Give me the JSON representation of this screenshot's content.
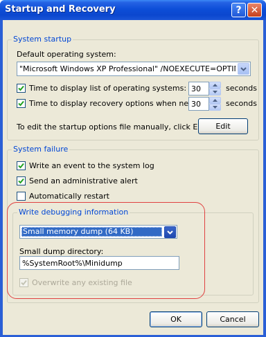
{
  "window": {
    "title": "Startup and Recovery",
    "help_glyph": "?",
    "close_glyph": "✕"
  },
  "startup": {
    "group_label": "System startup",
    "default_os_label": "Default operating system:",
    "default_os_value": "\"Microsoft Windows XP Professional\" /NOEXECUTE=OPTIN /FASTI",
    "time_os_list": {
      "label": "Time to display list of operating systems:",
      "checked": true,
      "value": "30",
      "unit": "seconds"
    },
    "time_recovery": {
      "label": "Time to display recovery options when needed:",
      "checked": true,
      "value": "30",
      "unit": "seconds"
    },
    "edit_hint": "To edit the startup options file manually, click Edit.",
    "edit_button": "Edit"
  },
  "failure": {
    "group_label": "System failure",
    "write_event": {
      "label": "Write an event to the system log",
      "checked": true
    },
    "send_alert": {
      "label": "Send an administrative alert",
      "checked": true
    },
    "auto_restart": {
      "label": "Automatically restart",
      "checked": false
    }
  },
  "debug": {
    "group_label": "Write debugging information",
    "dump_type": "Small memory dump (64 KB)",
    "dir_label": "Small dump directory:",
    "dir_value": "%SystemRoot%\\Minidump",
    "overwrite": {
      "label": "Overwrite any existing file",
      "checked": true,
      "disabled": true
    }
  },
  "buttons": {
    "ok": "OK",
    "cancel": "Cancel"
  },
  "colors": {
    "title_blue": "#0b47cf",
    "group_label": "#0046d5",
    "highlight_oval": "#e04040",
    "check_green": "#21a121"
  }
}
